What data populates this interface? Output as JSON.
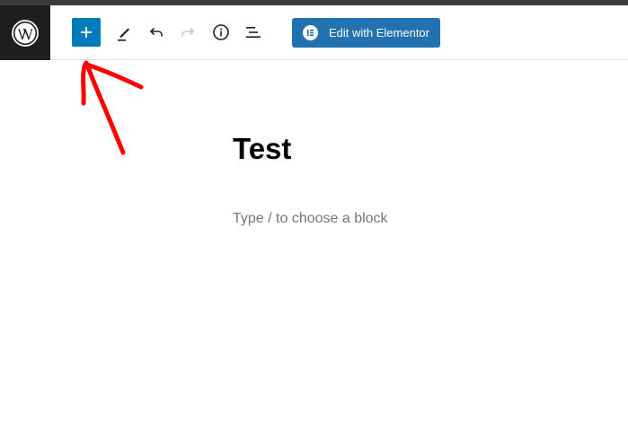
{
  "toolbar": {
    "add_block_tooltip": "Toggle block inserter",
    "tools_tooltip": "Tools",
    "undo_tooltip": "Undo",
    "redo_tooltip": "Redo",
    "details_tooltip": "Details",
    "list_view_tooltip": "List View",
    "elementor_label": "Edit with Elementor"
  },
  "editor": {
    "title": "Test",
    "block_placeholder": "Type / to choose a block"
  },
  "colors": {
    "wp_dark": "#1e1e1e",
    "accent": "#007cba",
    "elementor_blue": "#2271b1",
    "annotation_red": "#ff0000"
  },
  "icons": [
    "wordpress-logo-icon",
    "plus-icon",
    "pencil-icon",
    "undo-icon",
    "redo-icon",
    "info-icon",
    "list-view-icon",
    "elementor-icon"
  ]
}
